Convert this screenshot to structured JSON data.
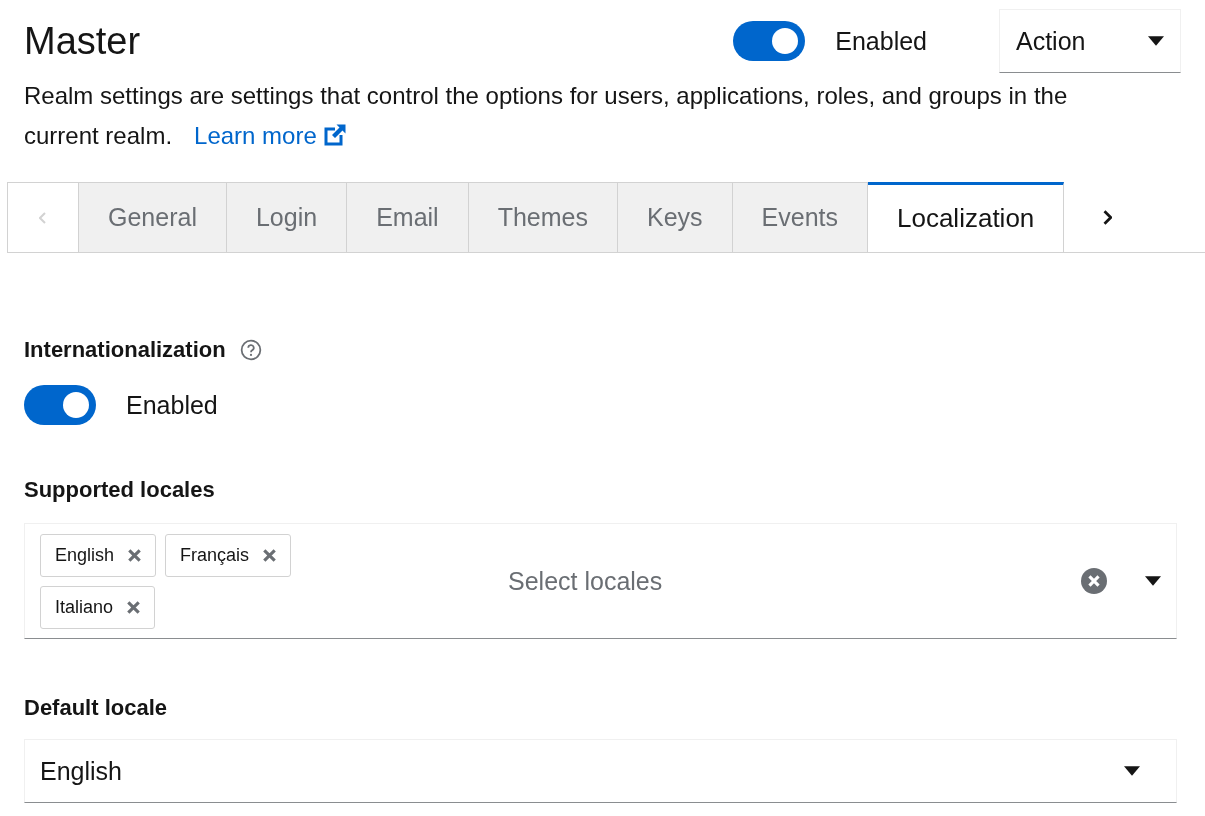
{
  "header": {
    "title": "Master",
    "enabled_switch": {
      "label": "Enabled",
      "on": true
    },
    "action_menu": {
      "label": "Action"
    }
  },
  "description": {
    "text": "Realm settings are settings that control the options for users, applications, roles, and groups in the current realm.",
    "link": "Learn more"
  },
  "tabs": [
    {
      "label": "General",
      "selected": false
    },
    {
      "label": "Login",
      "selected": false
    },
    {
      "label": "Email",
      "selected": false
    },
    {
      "label": "Themes",
      "selected": false
    },
    {
      "label": "Keys",
      "selected": false
    },
    {
      "label": "Events",
      "selected": false
    },
    {
      "label": "Localization",
      "selected": true
    }
  ],
  "internationalization": {
    "label": "Internationalization",
    "switch": {
      "label": "Enabled",
      "on": true
    }
  },
  "supported_locales": {
    "label": "Supported locales",
    "chips": [
      "English",
      "Français",
      "Italiano"
    ],
    "placeholder": "Select locales"
  },
  "default_locale": {
    "label": "Default locale",
    "value": "English"
  }
}
